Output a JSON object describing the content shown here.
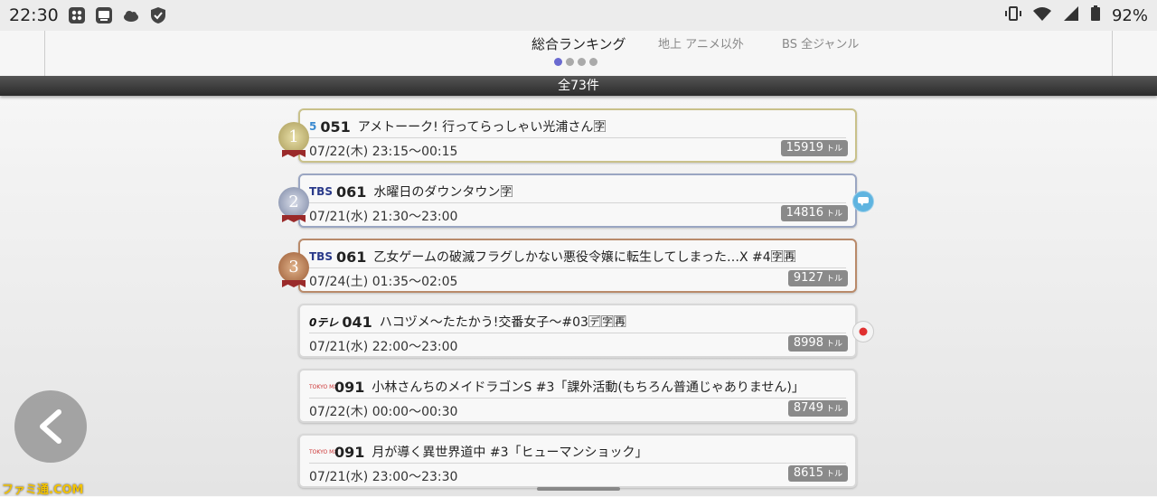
{
  "status": {
    "time": "22:30",
    "battery": "92%"
  },
  "tabs": [
    {
      "label": "総合ランキング"
    },
    {
      "label": "地上 アニメ以外"
    },
    {
      "label": "BS 全ジャンル"
    }
  ],
  "count_label": "全73件",
  "rankings": [
    {
      "rank": "1",
      "logo": "5",
      "channel": "051",
      "title": "アメトーーク! 行ってらっしゃい光浦さん🈑",
      "datetime": "07/22(木) 23:15〜00:15",
      "count": "15919",
      "unit": "トル"
    },
    {
      "rank": "2",
      "logo": "TBS",
      "channel": "061",
      "title": "水曜日のダウンタウン🈑",
      "datetime": "07/21(水) 21:30〜23:00",
      "count": "14816",
      "unit": "トル"
    },
    {
      "rank": "3",
      "logo": "TBS",
      "channel": "061",
      "title": "乙女ゲームの破滅フラグしかない悪役令嬢に転生してしまった…X #4🈑🈞",
      "datetime": "07/24(土) 01:35〜02:05",
      "count": "9127",
      "unit": "トル"
    },
    {
      "rank": "",
      "logo": "0テレ",
      "channel": "041",
      "title": "ハコヅメ〜たたかう!交番女子〜#03🈓🈑🈞",
      "datetime": "07/21(水) 22:00〜23:00",
      "count": "8998",
      "unit": "トル"
    },
    {
      "rank": "",
      "logo": "TOKYO MX",
      "channel": "091",
      "title": "小林さんちのメイドラゴンS #3「課外活動(もちろん普通じゃありません)」",
      "datetime": "07/22(木) 00:00〜00:30",
      "count": "8749",
      "unit": "トル"
    },
    {
      "rank": "",
      "logo": "TOKYO MX",
      "channel": "091",
      "title": "月が導く異世界道中 #3「ヒューマンショック」",
      "datetime": "07/21(水) 23:00〜23:30",
      "count": "8615",
      "unit": "トル"
    }
  ],
  "watermark": "ファミ通.COM",
  "colors": {
    "accent_dot": "#6a6ad0",
    "count_bar": "#333333",
    "record": "#e03030",
    "comment": "#5fb4e0"
  }
}
